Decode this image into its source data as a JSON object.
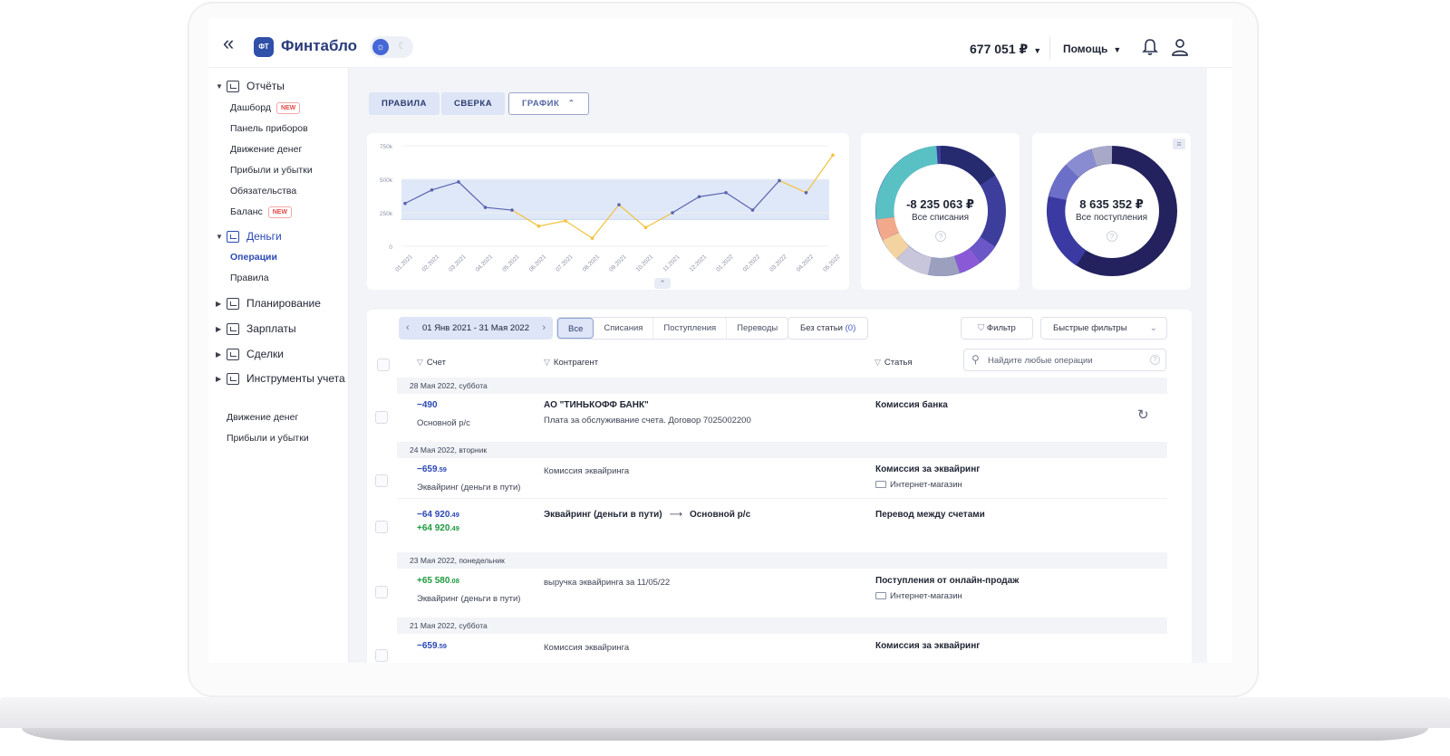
{
  "header": {
    "collapse": "«",
    "logo": "ФТ",
    "brand": "Финтабло",
    "balance": "677 051 ₽",
    "help": "Помощь"
  },
  "sidebar": {
    "reports": {
      "label": "Отчёты",
      "items": [
        {
          "label": "Дашборд",
          "badge": "NEW"
        },
        {
          "label": "Панель приборов"
        },
        {
          "label": "Движение денег"
        },
        {
          "label": "Прибыли и убытки"
        },
        {
          "label": "Обязательства"
        },
        {
          "label": "Баланс",
          "badge": "NEW"
        }
      ]
    },
    "money": {
      "label": "Деньги",
      "items": [
        {
          "label": "Операции"
        },
        {
          "label": "Правила"
        }
      ]
    },
    "groups": [
      "Планирование",
      "Зарплаты",
      "Сделки",
      "Инструменты учета"
    ],
    "extra": [
      "Движение денег",
      "Прибыли и убытки"
    ]
  },
  "tabs": [
    "ПРАВИЛА",
    "СВЕРКА",
    "ГРАФИК"
  ],
  "chart_data": {
    "type": "line",
    "x": [
      "01.2021",
      "02.2021",
      "03.2021",
      "04.2021",
      "05.2021",
      "06.2021",
      "07.2021",
      "08.2021",
      "09.2021",
      "10.2021",
      "11.2021",
      "12.2021",
      "01.2022",
      "02.2022",
      "03.2022",
      "04.2022",
      "05.2022"
    ],
    "yticks": [
      "750k",
      "500k",
      "250k",
      "0"
    ],
    "ylim": [
      0,
      750000
    ],
    "band": [
      200000,
      500000
    ],
    "series": [
      {
        "color": "#5a64b0",
        "values": [
          320000,
          420000,
          480000,
          290000,
          270000,
          150000,
          190000,
          60000,
          310000,
          140000,
          250000,
          370000,
          400000,
          270000,
          490000,
          400000,
          680000
        ]
      },
      {
        "color": "#f3c13a",
        "values": [
          320000,
          420000,
          480000,
          290000,
          270000,
          150000,
          190000,
          60000,
          310000,
          140000,
          250000,
          370000,
          400000,
          270000,
          490000,
          400000,
          680000
        ]
      }
    ]
  },
  "donuts": [
    {
      "sum": "-8 235 063 ₽",
      "label": "Все списания"
    },
    {
      "sum": "8 635 352 ₽",
      "label": "Все поступления"
    }
  ],
  "ops": {
    "date_range": "01 Янв 2021 - 31 Мая 2022",
    "filters": [
      "Все",
      "Списания",
      "Поступления",
      "Переводы"
    ],
    "no_category": "Без статьи",
    "no_category_count": "(0)",
    "filter": "Фильтр",
    "quick_filters": "Быстрые фильтры",
    "columns": {
      "account": "Счет",
      "counterparty": "Контрагент",
      "category": "Статья"
    },
    "search_placeholder": "Найдите любые операции",
    "days": [
      "28 Мая 2022, суббота",
      "24 Мая 2022, вторник",
      "23 Мая 2022, понедельник",
      "21 Мая 2022, суббота"
    ],
    "rows": [
      {
        "amount": "−490",
        "account": "Основной р/с",
        "counterparty": "АО \"ТИНЬКОФФ БАНК\"",
        "description": "Плата за обслуживание счета. Договор 7025002200",
        "category": "Комиссия банка"
      },
      {
        "amount": "−659",
        "cents": ".59",
        "account": "Эквайринг (деньги в пути)",
        "description": "Комиссия эквайринга",
        "category": "Комиссия за эквайринг",
        "project": "Интернет-магазин"
      },
      {
        "amount": "−64 920",
        "cents": ".49",
        "amount2": "+64 920",
        "cents2": ".49",
        "from": "Эквайринг (деньги в пути)",
        "to": "Основной р/с",
        "category": "Перевод между счетами"
      },
      {
        "amount": "+65 580",
        "cents": ".08",
        "account": "Эквайринг (деньги в пути)",
        "description": "выручка эквайринга за 11/05/22",
        "category": "Поступления от онлайн-продаж",
        "project": "Интернет-магазин"
      },
      {
        "amount": "−659",
        "cents": ".59",
        "description": "Комиссия эквайринга",
        "category": "Комиссия за эквайринг"
      }
    ]
  }
}
